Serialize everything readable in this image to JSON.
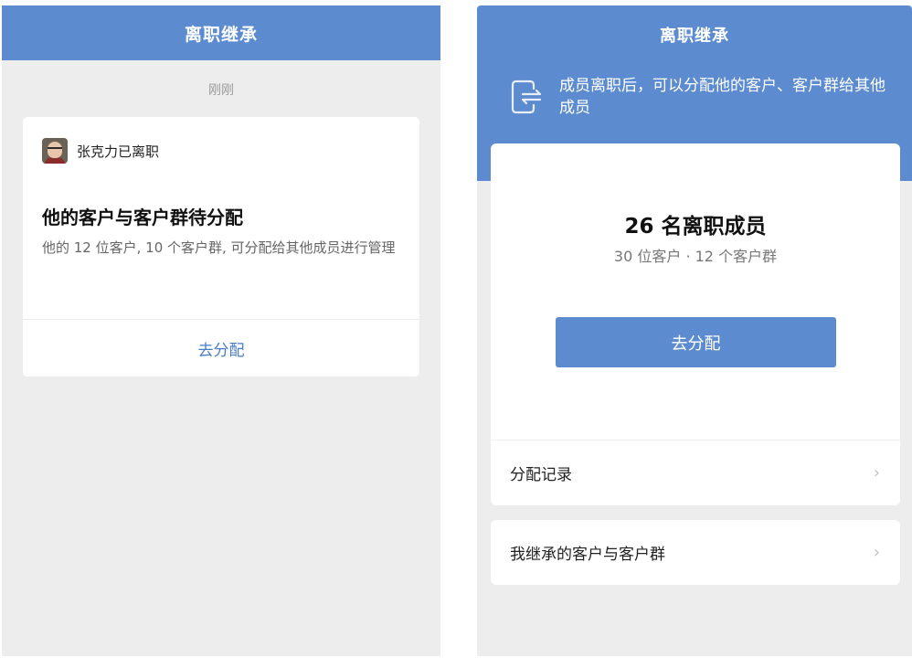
{
  "left": {
    "nav_title": "离职继承",
    "timestamp": "刚刚",
    "notice": {
      "member_status": "张克力已离职",
      "title": "他的客户与客户群待分配",
      "description": "他的 12 位客户, 10 个客户群, 可分配给其他成员进行管理",
      "action_label": "去分配"
    }
  },
  "right": {
    "nav_title": "离职继承",
    "banner_text": "成员离职后，可以分配他的客户、客户群给其他成员",
    "summary": {
      "title": "26 名离职成员",
      "subtitle": "30 位客户 · 12 个客户群",
      "button_label": "去分配"
    },
    "rows": [
      {
        "label": "分配记录"
      },
      {
        "label": "我继承的客户与客户群"
      }
    ],
    "chevron": "›"
  },
  "colors": {
    "brand_blue": "#5c8ccf",
    "link_blue": "#4a7cc6",
    "background_gray": "#ededed"
  },
  "icons": {
    "avatar": "avatar",
    "exit": "exit-transfer-icon",
    "chevron": "chevron-right-icon"
  }
}
